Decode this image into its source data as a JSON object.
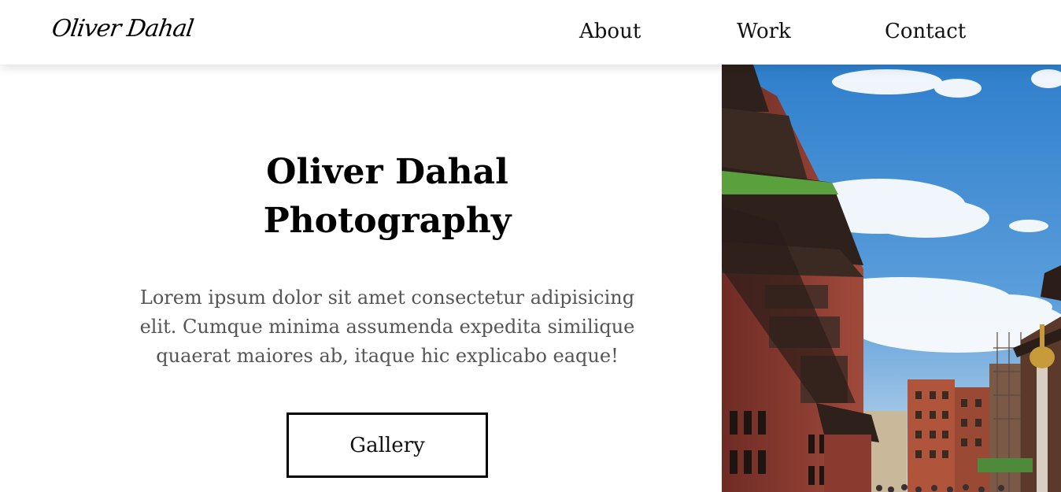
{
  "nav": {
    "logo": "Oliver Dahal",
    "links": [
      "About",
      "Work",
      "Contact"
    ]
  },
  "hero": {
    "title_line1": "Oliver Dahal",
    "title_line2": "Photography",
    "description": "Lorem ipsum dolor sit amet consectetur adipisicing elit. Cumque minima assumenda expedita similique quaerat maiores ab, itaque hic explicabo eaque!",
    "button_label": "Gallery"
  },
  "colors": {
    "sky": "#3a86cf",
    "brick": "#8f3a2f",
    "roof": "#3a2a22",
    "text": "#111111",
    "muted_text": "#555555"
  }
}
